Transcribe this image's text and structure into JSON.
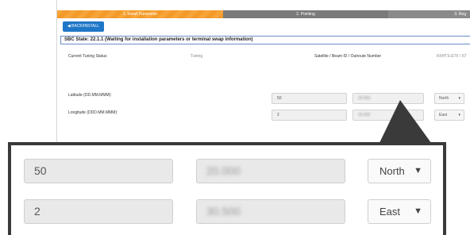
{
  "steps": [
    {
      "label": "1. Install Parameter"
    },
    {
      "label": "2. Pointing"
    },
    {
      "label": "3. Reg"
    }
  ],
  "back_button": {
    "label": "◀ BACK/INSTALL"
  },
  "sbc_state": "SBC State: 22.1.1 (Waiting for installation parameters or terminal swap information)",
  "status_row": {
    "label": "Current Tuning Status",
    "value": "Tuning",
    "satellite_label": "Satellite / Beam ID / Outroute Number",
    "satellite_value": "KKHTS-ETF / 67"
  },
  "latitude": {
    "label": "Latitude (DD.MM.MMM):",
    "degrees": "50",
    "minutes": "20.000",
    "direction": "North"
  },
  "longitude": {
    "label": "Longitude (DDD.MM.MMM):",
    "degrees": "2",
    "minutes": "30.500",
    "direction": "East"
  }
}
